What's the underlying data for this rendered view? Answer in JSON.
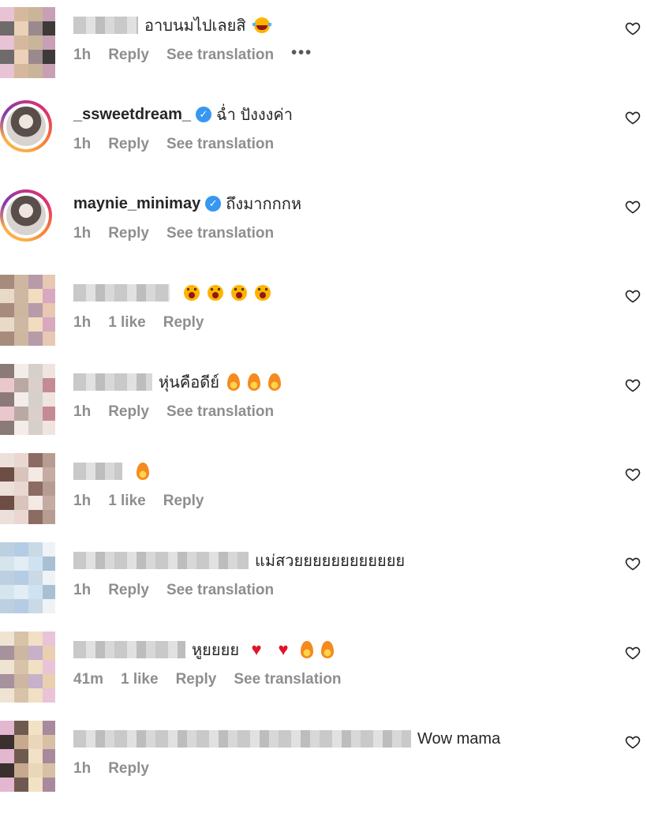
{
  "comments": [
    {
      "avatar": "pixel",
      "blur_w": 82,
      "username": "",
      "verified": false,
      "text": "อาบนมไปเลยสิ",
      "emojis": [
        "laugh"
      ],
      "time": "1h",
      "likes": "",
      "reply": "Reply",
      "translate": "See translation",
      "more": "•••"
    },
    {
      "avatar": "ring",
      "blur_w": 0,
      "username": "_ssweetdream_",
      "verified": true,
      "text": "ฉ่ำ ปังงงค่า",
      "emojis": [],
      "time": "1h",
      "likes": "",
      "reply": "Reply",
      "translate": "See translation",
      "more": ""
    },
    {
      "avatar": "ring",
      "blur_w": 0,
      "username": "maynie_minimay",
      "verified": true,
      "text": "ถึงมากกกห",
      "emojis": [],
      "time": "1h",
      "likes": "",
      "reply": "Reply",
      "translate": "See translation",
      "more": ""
    },
    {
      "avatar": "pixel",
      "blur_w": 122,
      "username": "",
      "verified": false,
      "text": "",
      "emojis": [
        "face",
        "face",
        "face",
        "face"
      ],
      "time": "1h",
      "likes": "1 like",
      "reply": "Reply",
      "translate": "",
      "more": ""
    },
    {
      "avatar": "pixel",
      "blur_w": 100,
      "username": "",
      "verified": false,
      "text": "หุ่นคือดีย์",
      "emojis": [
        "fire",
        "fire",
        "fire"
      ],
      "time": "1h",
      "likes": "",
      "reply": "Reply",
      "translate": "See translation",
      "more": ""
    },
    {
      "avatar": "pixel",
      "blur_w": 62,
      "username": "",
      "verified": false,
      "text": "",
      "emojis": [
        "fire"
      ],
      "time": "1h",
      "likes": "1 like",
      "reply": "Reply",
      "translate": "",
      "more": ""
    },
    {
      "avatar": "pixel",
      "blur_w": 222,
      "username": "",
      "verified": false,
      "text": "แม่สวยยยยยยยยยยยย",
      "emojis": [],
      "time": "1h",
      "likes": "",
      "reply": "Reply",
      "translate": "See translation",
      "more": ""
    },
    {
      "avatar": "pixel",
      "blur_w": 142,
      "username": "",
      "verified": false,
      "text": "หูยยยย",
      "emojis": [
        "heart",
        "heart",
        "fire",
        "fire"
      ],
      "time": "41m",
      "likes": "1 like",
      "reply": "Reply",
      "translate": "See translation",
      "more": ""
    },
    {
      "avatar": "pixel",
      "blur_w": 428,
      "username": "",
      "verified": false,
      "text": "Wow mama",
      "emojis": [],
      "time": "1h",
      "likes": "",
      "reply": "Reply",
      "translate": "",
      "more": ""
    }
  ],
  "icons": {
    "like": "heart-outline-icon",
    "verified": "verified-badge-icon"
  },
  "colors": {
    "primary_text": "#262626",
    "secondary_text": "#8e8e8e",
    "verified": "#3897f0",
    "like_red": "#e0142a"
  }
}
